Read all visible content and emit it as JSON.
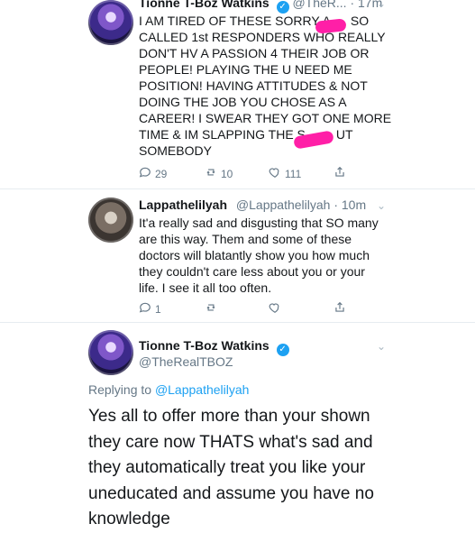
{
  "tweet1": {
    "name": "Tionne T-Boz Watkins",
    "handle_time": "@TheR... · 17m",
    "text_lines": [
      "I AM TIRED OF THESE SORRY A",
      "SO",
      "CALLED 1st RESPONDERS WHO REALLY",
      "DON'T HV A PASSION 4 THEIR JOB OR",
      "PEOPLE! PLAYING THE U NEED ME",
      "POSITION! HAVING ATTITUDES & NOT",
      "DOING THE JOB YOU CHOSE AS A",
      "CAREER! I SWEAR THEY GOT ONE MORE",
      "TIME & IM SLAPPING THE S",
      "UT",
      "SOMEBODY"
    ],
    "counts": {
      "replies": "29",
      "retweets": "10",
      "likes": "111"
    }
  },
  "tweet2": {
    "name": "Lappathelilyah",
    "handle_time": "@Lappathelilyah · 10m",
    "text_lines": [
      "It'a really sad and disgusting that SO many",
      "are this way. Them and some of these",
      "doctors will blatantly show you how much",
      "they couldn't care less about you or your",
      "life. I see it all too often."
    ],
    "counts": {
      "replies": "1"
    }
  },
  "tweet3": {
    "name": "Tionne T-Boz Watkins",
    "handle": "@TheRealTBOZ",
    "replying_prefix": "Replying to",
    "replying_handle": "@Lappathelilyah",
    "text_lines": [
      "Yes all to offer more than your shown",
      "they care now THATS what's sad and",
      "they automatically treat you like your",
      "uneducated and assume you have no",
      "knowledge"
    ]
  },
  "icons": {
    "verified": "✓",
    "chevron": "⌄",
    "reply": "reply-icon",
    "retweet": "retweet-icon",
    "like": "heart-icon",
    "share": "share-icon"
  },
  "colors": {
    "text": "#14171a",
    "muted": "#657786",
    "link": "#1da1f2",
    "redaction": "#ff1fa7",
    "divider": "#e6ecf0"
  }
}
